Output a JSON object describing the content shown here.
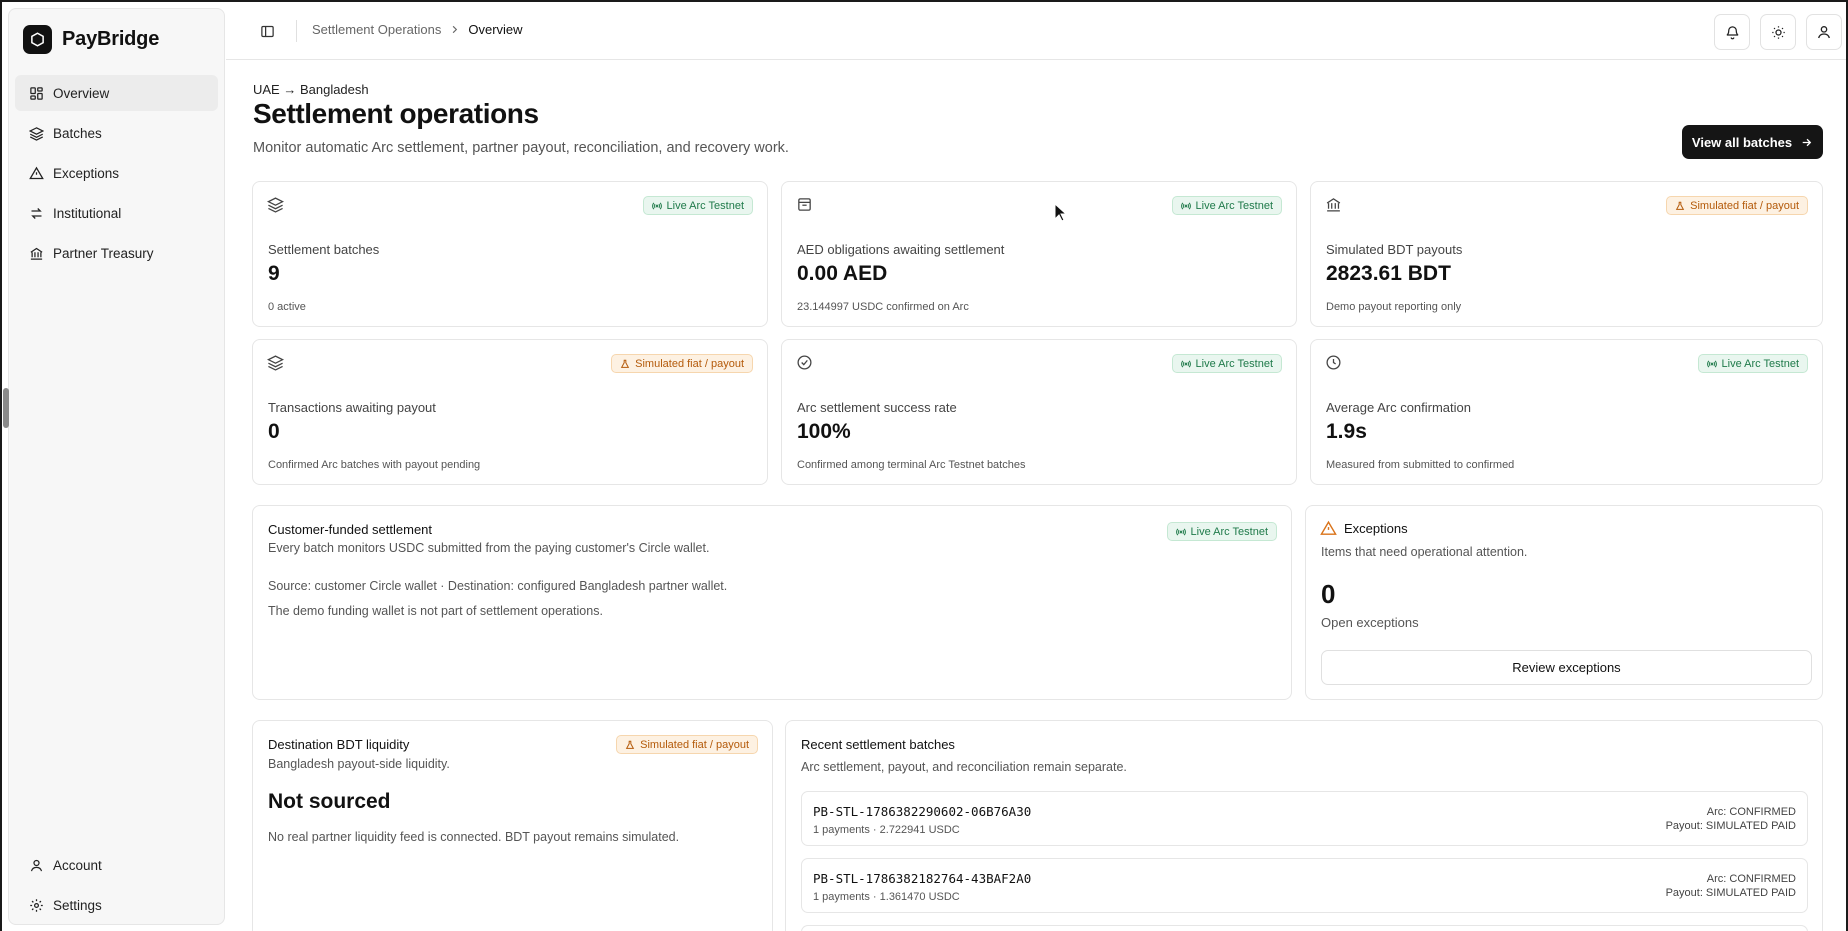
{
  "app": {
    "name": "PayBridge"
  },
  "sidebar": {
    "items": [
      {
        "label": "Overview",
        "icon": "grid-icon",
        "active": true
      },
      {
        "label": "Batches",
        "icon": "layers-icon"
      },
      {
        "label": "Exceptions",
        "icon": "warning-icon"
      },
      {
        "label": "Institutional",
        "icon": "transfer-icon"
      },
      {
        "label": "Partner Treasury",
        "icon": "bank-icon"
      }
    ],
    "bottom": [
      {
        "label": "Account",
        "icon": "user-icon"
      },
      {
        "label": "Settings",
        "icon": "gear-icon"
      }
    ]
  },
  "topbar": {
    "breadcrumb": {
      "parent": "Settlement Operations",
      "current": "Overview"
    }
  },
  "page": {
    "eyebrow": "UAE → Bangladesh",
    "title": "Settlement operations",
    "subtitle": "Monitor automatic Arc settlement, partner payout, reconciliation, and recovery work.",
    "primary_button": "View all batches"
  },
  "badges": {
    "live": "Live Arc Testnet",
    "simulated": "Simulated fiat / payout"
  },
  "metrics": [
    {
      "label": "Settlement batches",
      "value": "9",
      "note": "0 active",
      "badge": "live",
      "icon": "layers-icon"
    },
    {
      "label": "AED obligations awaiting settlement",
      "value": "0.00 AED",
      "note": "23.144997 USDC confirmed on Arc",
      "badge": "live",
      "icon": "receipt-icon"
    },
    {
      "label": "Simulated BDT payouts",
      "value": "2823.61 BDT",
      "note": "Demo payout reporting only",
      "badge": "simulated",
      "icon": "bank-icon"
    },
    {
      "label": "Transactions awaiting payout",
      "value": "0",
      "note": "Confirmed Arc batches with payout pending",
      "badge": "simulated",
      "icon": "layers-icon"
    },
    {
      "label": "Arc settlement success rate",
      "value": "100%",
      "note": "Confirmed among terminal Arc Testnet batches",
      "badge": "live",
      "icon": "check-circle-icon"
    },
    {
      "label": "Average Arc confirmation",
      "value": "1.9s",
      "note": "Measured from submitted to confirmed",
      "badge": "live",
      "icon": "clock-icon"
    }
  ],
  "customer_funded": {
    "title": "Customer-funded settlement",
    "subtitle": "Every batch monitors USDC submitted from the paying customer's Circle wallet.",
    "line1": "Source: customer Circle wallet · Destination: configured Bangladesh partner wallet.",
    "line2": "The demo funding wallet is not part of settlement operations."
  },
  "exceptions": {
    "title": "Exceptions",
    "subtitle": "Items that need operational attention.",
    "count": "0",
    "count_label": "Open exceptions",
    "button": "Review exceptions"
  },
  "liquidity": {
    "title": "Destination BDT liquidity",
    "subtitle": "Bangladesh payout-side liquidity.",
    "value": "Not sourced",
    "note": "No real partner liquidity feed is connected. BDT payout remains simulated."
  },
  "recent": {
    "title": "Recent settlement batches",
    "subtitle": "Arc settlement, payout, and reconciliation remain separate.",
    "batches": [
      {
        "id": "PB-STL-1786382290602-06B76A30",
        "meta": "1 payments · 2.722941 USDC",
        "arc": "Arc: CONFIRMED",
        "payout": "Payout: SIMULATED PAID"
      },
      {
        "id": "PB-STL-1786382182764-43BAF2A0",
        "meta": "1 payments · 1.361470 USDC",
        "arc": "Arc: CONFIRMED",
        "payout": "Payout: SIMULATED PAID"
      }
    ]
  }
}
